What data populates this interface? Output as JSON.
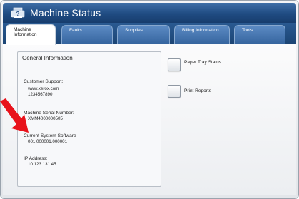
{
  "window": {
    "title": "Machine Status"
  },
  "tabs": [
    {
      "label": "Machine\nInformation"
    },
    {
      "label": "Faults"
    },
    {
      "label": "Supplies"
    },
    {
      "label": "Billing Information"
    },
    {
      "label": "Tools"
    }
  ],
  "general_info": {
    "heading": "General Information",
    "customer_support_label": "Customer Support:",
    "customer_support_url": "www.xerox.com",
    "customer_support_phone": "1234567890",
    "serial_label": "Machine Serial Number:",
    "serial_value": "XMM4000000505",
    "software_label": "Current System Software",
    "software_value": "001.000001.000001",
    "ip_label": "IP Address:",
    "ip_value": "10.123.131.45"
  },
  "actions": {
    "paper_tray_status": "Paper Tray Status",
    "print_reports": "Print Reports"
  },
  "colors": {
    "titlebar": "#1f4b82",
    "tab_inactive": "#35649e",
    "arrow": "#e8121b"
  }
}
